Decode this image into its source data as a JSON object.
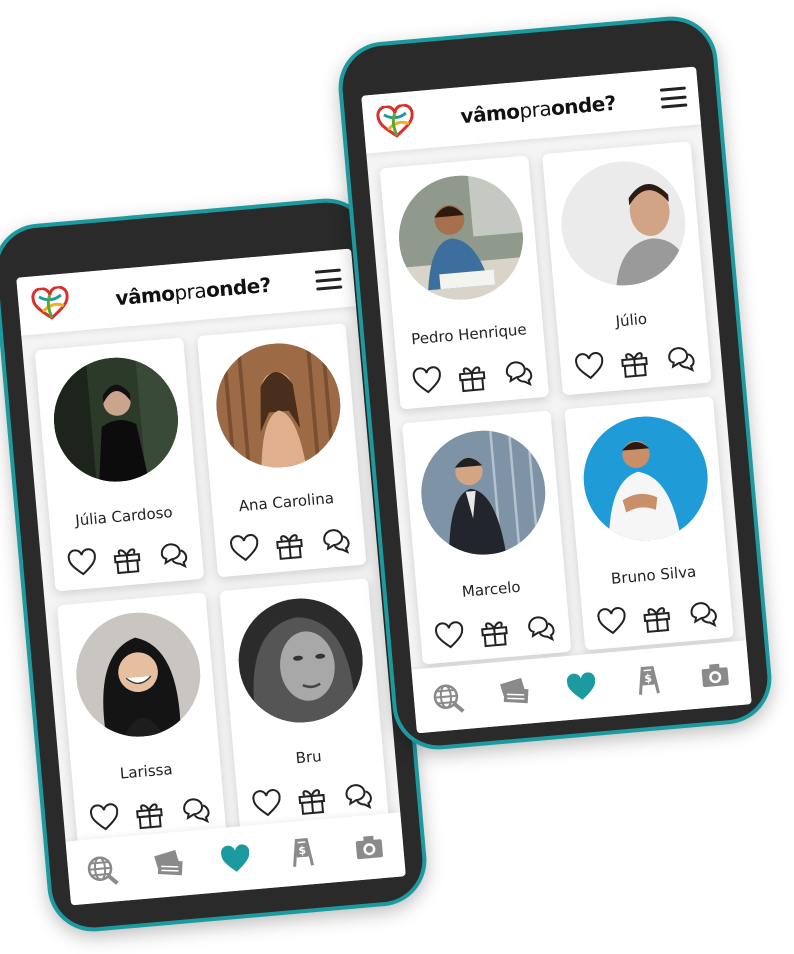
{
  "app": {
    "brand_bold_1": "vâmo",
    "brand_light": "pra",
    "brand_bold_2": "onde?"
  },
  "colors": {
    "accent": "#1b9aa0",
    "icon_gray": "#8a8a8a",
    "phone_body": "#2a2a2a"
  },
  "left_phone": {
    "profiles": [
      {
        "name": "Júlia Cardoso"
      },
      {
        "name": "Ana Carolina"
      },
      {
        "name": "Larissa"
      },
      {
        "name": "Bru"
      }
    ]
  },
  "right_phone": {
    "profiles": [
      {
        "name": "Pedro Henrique"
      },
      {
        "name": "Júlio"
      },
      {
        "name": "Marcelo"
      },
      {
        "name": "Bruno Silva"
      }
    ]
  },
  "icons": {
    "card_actions": [
      "heart-icon",
      "gift-icon",
      "chat-icon"
    ],
    "nav": [
      "globe-icon",
      "tickets-icon",
      "heart-icon",
      "price-sign-icon",
      "camera-icon"
    ]
  }
}
